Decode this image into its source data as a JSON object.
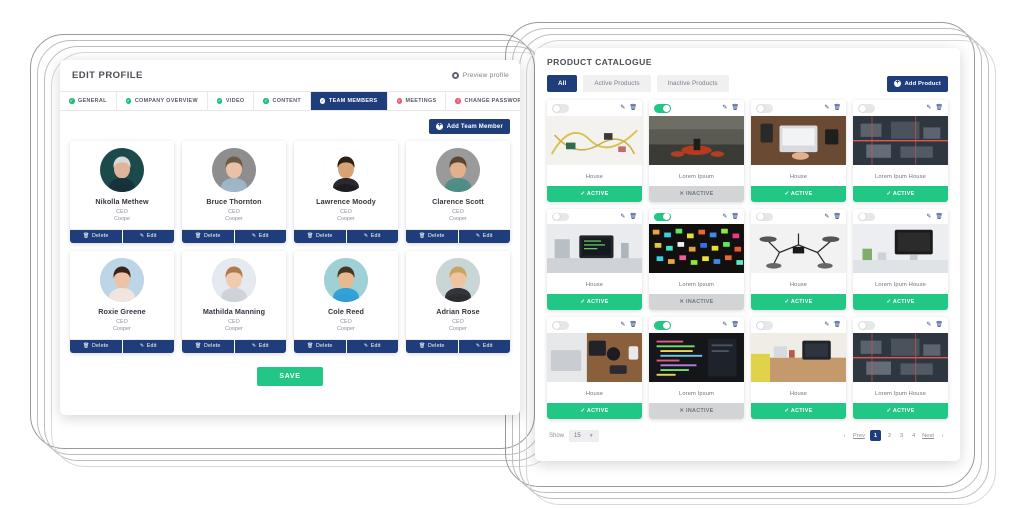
{
  "left_panel": {
    "title": "EDIT PROFILE",
    "preview_label": "Preview profile",
    "preview_icon": "gear-icon",
    "tabs": [
      {
        "label": "GENERAL",
        "state": "ok",
        "active": false
      },
      {
        "label": "COMPANY OVERVIEW",
        "state": "ok",
        "active": false
      },
      {
        "label": "VIDEO",
        "state": "ok",
        "active": false
      },
      {
        "label": "CONTENT",
        "state": "ok",
        "active": false
      },
      {
        "label": "TEAM MEMBERS",
        "state": "white",
        "active": true
      },
      {
        "label": "MEETINGS",
        "state": "warn",
        "active": false
      },
      {
        "label": "CHANGE PASSWORD",
        "state": "warn",
        "active": false
      }
    ],
    "add_member_label": "Add Team Member",
    "add_member_icon": "plus-circle-icon",
    "delete_label": "Delete",
    "edit_label": "Edit",
    "delete_icon": "trash-icon",
    "edit_icon": "pencil-icon",
    "save_label": "SAVE",
    "members": [
      {
        "name": "Nikolla Methew",
        "role": "CEO",
        "company": "Coope",
        "avatar_bg": "#1c4a4a",
        "skin": "#e0b49a",
        "hair": "#d9d9d9",
        "shirt": "#17323a"
      },
      {
        "name": "Bruce Thornton",
        "role": "CEO",
        "company": "Cooper",
        "avatar_bg": "#8e8e8e",
        "skin": "#e8c1a6",
        "hair": "#6b5a4a",
        "shirt": "#9fb7c9"
      },
      {
        "name": "Lawrence Moody",
        "role": "CEO",
        "company": "Cooper",
        "avatar_bg": "#ffffff",
        "skin": "#d8a274",
        "hair": "#2b2118",
        "shirt": "#1d1d24"
      },
      {
        "name": "Clarence Scott",
        "role": "CEO",
        "company": "Cooper",
        "avatar_bg": "#9a9a9a",
        "skin": "#e3b08c",
        "hair": "#5a4434",
        "shirt": "#4e8c86"
      },
      {
        "name": "Roxie Greene",
        "role": "CEO",
        "company": "Cooper",
        "avatar_bg": "#bcd6e8",
        "skin": "#ecc3a4",
        "hair": "#3a2418",
        "shirt": "#efe6dd"
      },
      {
        "name": "Mathilda Manning",
        "role": "CEO",
        "company": "Cooper",
        "avatar_bg": "#e5eaf0",
        "skin": "#f0cbae",
        "hair": "#b07a4a",
        "shirt": "#cfd3d8"
      },
      {
        "name": "Cole Reed",
        "role": "CEO",
        "company": "Cooper",
        "avatar_bg": "#9ed0d6",
        "skin": "#e8b88f",
        "hair": "#4a3423",
        "shirt": "#2f9fd4"
      },
      {
        "name": "Adrian Rose",
        "role": "CEO",
        "company": "Cooper",
        "avatar_bg": "#c9d6d6",
        "skin": "#eec5a3",
        "hair": "#c9a45e",
        "shirt": "#2c2c33"
      }
    ]
  },
  "right_panel": {
    "title": "PRODUCT CATALOGUE",
    "filters": [
      {
        "label": "All",
        "active": true
      },
      {
        "label": "Active Products",
        "active": false
      },
      {
        "label": "Inactive Products",
        "active": false
      }
    ],
    "add_product_label": "Add Product",
    "add_product_icon": "plus-circle-icon",
    "edit_icon": "pencil-icon",
    "delete_icon": "trash-icon",
    "status_active_label": "ACTIVE",
    "status_inactive_label": "INACTIVE",
    "products": [
      {
        "name": "House",
        "status": "active",
        "toggle": false,
        "img": "wires"
      },
      {
        "name": "Lorem Ipsum",
        "status": "inactive",
        "toggle": true,
        "img": "warehouse"
      },
      {
        "name": "House",
        "status": "active",
        "toggle": false,
        "img": "desk-laptop"
      },
      {
        "name": "Lorem Ipum House",
        "status": "active",
        "toggle": false,
        "img": "circuit"
      },
      {
        "name": "House",
        "status": "active",
        "toggle": false,
        "img": "office-monitor"
      },
      {
        "name": "Lorem Ipsum",
        "status": "inactive",
        "toggle": true,
        "img": "mixer-lights"
      },
      {
        "name": "House",
        "status": "active",
        "toggle": false,
        "img": "drone-bw"
      },
      {
        "name": "Lorem Ipum House",
        "status": "active",
        "toggle": false,
        "img": "imac-desk"
      },
      {
        "name": "House",
        "status": "active",
        "toggle": false,
        "img": "coffee-desk"
      },
      {
        "name": "Lorem Ipsum",
        "status": "inactive",
        "toggle": true,
        "img": "code-screen"
      },
      {
        "name": "House",
        "status": "active",
        "toggle": false,
        "img": "wood-desk"
      },
      {
        "name": "Lorem Ipum House",
        "status": "active",
        "toggle": false,
        "img": "circuit"
      }
    ],
    "footer": {
      "show_label": "Show",
      "page_size": "15",
      "prev_label": "Prev",
      "next_label": "Next",
      "pages": [
        "1",
        "2",
        "3",
        "4"
      ],
      "current_page": "1"
    }
  },
  "colors": {
    "navy": "#1f3d7a",
    "green": "#22c786",
    "pink": "#ef5a78",
    "gray_chip": "#f0f0f1"
  }
}
